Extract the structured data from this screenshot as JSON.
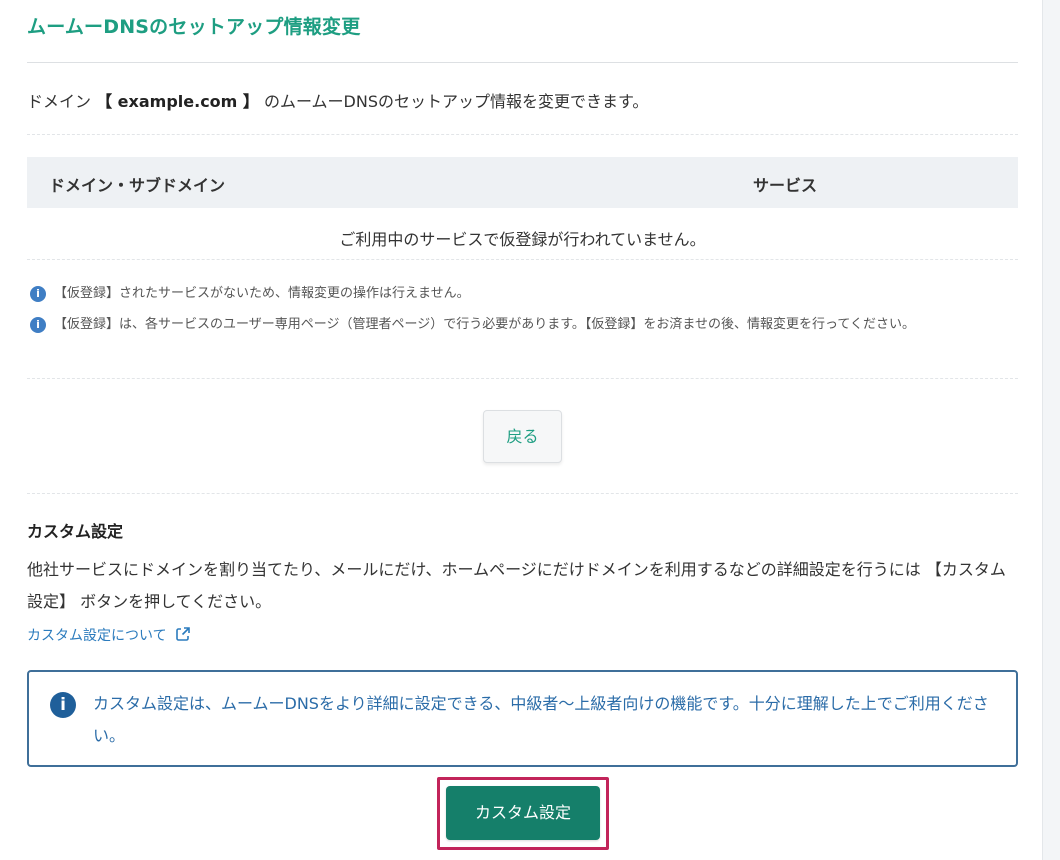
{
  "page": {
    "title": "ムームーDNSのセットアップ情報変更"
  },
  "intro": {
    "prefix": "ドメイン",
    "domain_bracketed": "【 example.com 】",
    "suffix": " のムームーDNSのセットアップ情報を変更できます。"
  },
  "table": {
    "columns": [
      "ドメイン・サブドメイン",
      "サービス"
    ],
    "empty_message": "ご利用中のサービスで仮登録が行われていません。"
  },
  "notes": [
    {
      "icon": "info-icon",
      "text": "【仮登録】されたサービスがないため、情報変更の操作は行えません。"
    },
    {
      "icon": "info-icon",
      "text": "【仮登録】は、各サービスのユーザー専用ページ（管理者ページ）で行う必要があります。【仮登録】をお済ませの後、情報変更を行ってください。"
    }
  ],
  "back_button": {
    "label": "戻る"
  },
  "custom": {
    "heading": "カスタム設定",
    "description": "他社サービスにドメインを割り当てたり、メールにだけ、ホームページにだけドメインを利用するなどの詳細設定を行うには 【カスタム設定】 ボタンを押してください。",
    "link_label": "カスタム設定について",
    "link_icon": "external-link-icon",
    "alert": {
      "icon": "info-icon",
      "text": "カスタム設定は、ムームーDNSをより詳細に設定できる、中級者〜上級者向けの機能です。十分に理解した上でご利用ください。"
    },
    "button_label": "カスタム設定"
  },
  "colors": {
    "title_green": "#1e9e82",
    "primary_button": "#157f6a",
    "link_blue": "#2b7bbd",
    "alert_border": "#3f6f99",
    "highlight_frame": "#c2245a"
  }
}
